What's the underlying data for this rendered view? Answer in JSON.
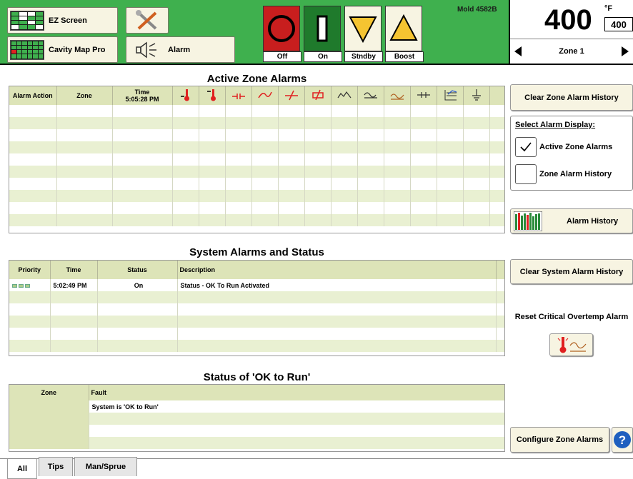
{
  "header": {
    "ez_screen": "EZ Screen",
    "cavity_map": "Cavity Map Pro",
    "alarm": "Alarm",
    "mold": "Mold 4582B",
    "states": [
      "Off",
      "On",
      "Stndby",
      "Boost"
    ],
    "temp_value": "400",
    "temp_unit": "°F",
    "temp_setpoint": "400",
    "zone_label": "Zone 1"
  },
  "active": {
    "title": "Active Zone Alarms",
    "col_action": "Alarm Action",
    "col_zone": "Zone",
    "col_time_label": "Time",
    "col_time_value": "5:05:28 PM",
    "icon_columns": [
      "high-temp-icon",
      "overtemp-icon",
      "open-thermocouple-icon",
      "reversed-thermocouple-icon",
      "shorted-thermocouple-icon",
      "heater-open-icon",
      "deviation-icon",
      "ground-fault-icon",
      "critical-overtemp-icon",
      "heater-short-icon",
      "zone-chart-icon",
      "ground-icon"
    ]
  },
  "side": {
    "clear_zone": "Clear Zone Alarm History",
    "select_display": "Select Alarm Display:",
    "active_option": "Active Zone Alarms",
    "history_option": "Zone Alarm History",
    "alarm_history": "Alarm History",
    "clear_system": "Clear System Alarm History",
    "reset_critical": "Reset Critical Overtemp Alarm",
    "configure": "Configure Zone Alarms"
  },
  "system": {
    "title": "System Alarms and Status",
    "headers": [
      "Priority",
      "Time",
      "Status",
      "Description"
    ],
    "row": {
      "time": "5:02:49 PM",
      "status": "On",
      "description": "Status - OK To Run Activated"
    }
  },
  "okrun": {
    "title": "Status of 'OK to Run'",
    "headers": [
      "Zone",
      "Fault"
    ],
    "fault": "System is 'OK to Run'"
  },
  "tabs": [
    "All",
    "Tips",
    "Man/Sprue"
  ]
}
